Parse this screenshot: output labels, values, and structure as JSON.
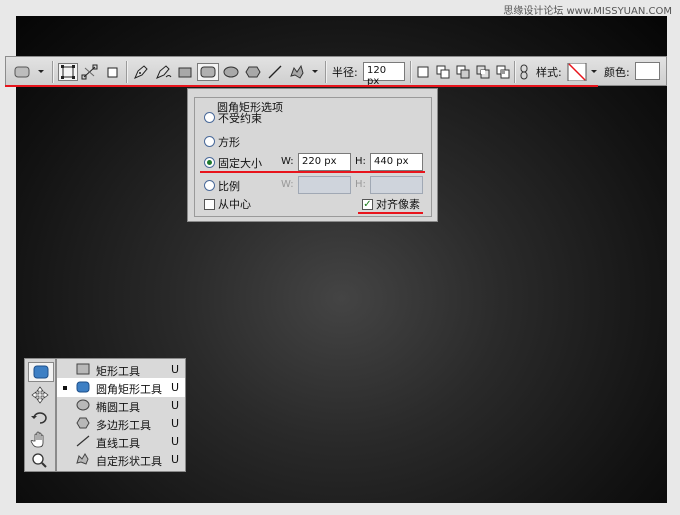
{
  "watermark": "思缘设计论坛 www.MISSYUAN.COM",
  "options_bar": {
    "radius_label": "半径:",
    "radius_value": "120 px",
    "style_label": "样式:",
    "color_label": "颜色:"
  },
  "rounded_rect_options": {
    "title": "圆角矩形选项",
    "opt_unconstrained": "不受约束",
    "opt_square": "方形",
    "opt_fixed_size": "固定大小",
    "opt_proportional": "比例",
    "from_center": "从中心",
    "snap_to_pixels": "对齐像素",
    "w_label": "W:",
    "h_label": "H:",
    "fixed_w": "220 px",
    "fixed_h": "440 px",
    "selected_option": "固定大小",
    "snap_checked": true,
    "from_center_checked": false
  },
  "tool_flyout": {
    "items": [
      {
        "label": "矩形工具",
        "key": "U",
        "icon": "rectangle-icon"
      },
      {
        "label": "圆角矩形工具",
        "key": "U",
        "icon": "rounded-rectangle-icon",
        "selected": true
      },
      {
        "label": "椭圆工具",
        "key": "U",
        "icon": "ellipse-icon"
      },
      {
        "label": "多边形工具",
        "key": "U",
        "icon": "polygon-icon"
      },
      {
        "label": "直线工具",
        "key": "U",
        "icon": "line-icon"
      },
      {
        "label": "自定形状工具",
        "key": "U",
        "icon": "custom-shape-icon"
      }
    ]
  },
  "colors": {
    "annotation_red": "#e8141c",
    "radio_green": "#1f7a2e"
  }
}
